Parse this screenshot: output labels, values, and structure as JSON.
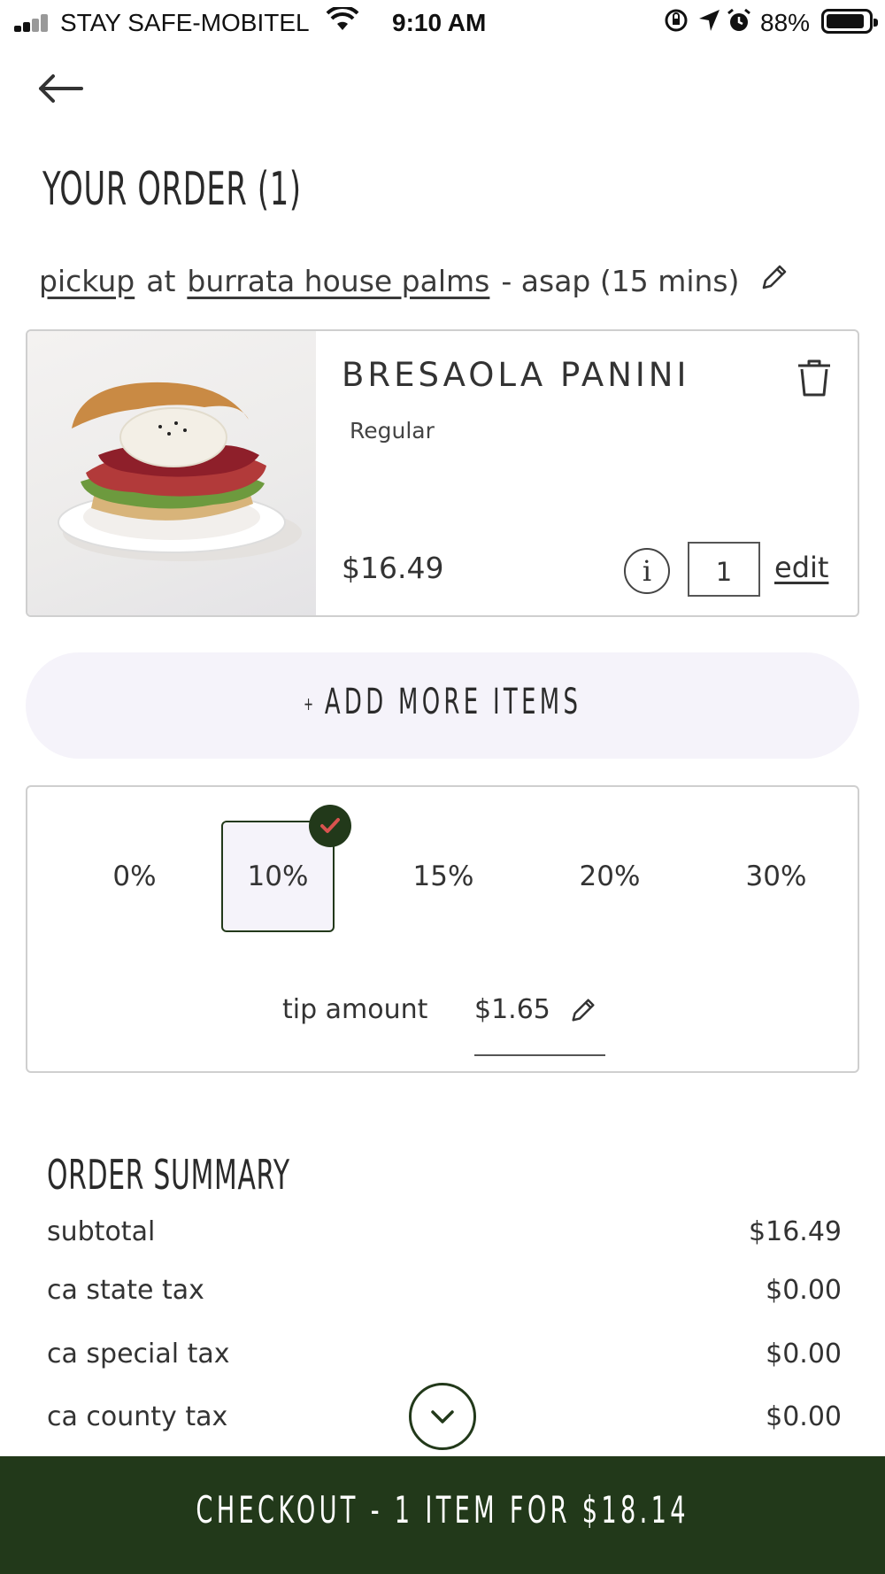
{
  "status_bar": {
    "carrier": "STAY SAFE-MOBITEL",
    "time": "9:10 AM",
    "battery": "88%",
    "icons": [
      "signal-icon",
      "wifi-icon",
      "orientation-lock-icon",
      "location-icon",
      "alarm-icon",
      "battery-icon"
    ]
  },
  "nav": {
    "back_icon": "arrow-left-icon"
  },
  "page": {
    "title": "YOUR ORDER (1)"
  },
  "pickup": {
    "mode": "pickup",
    "at": "at",
    "location": "burrata house palms",
    "time": "- asap (15 mins)",
    "edit_icon": "pencil-icon"
  },
  "item": {
    "name": "BRESAOLA PANINI",
    "variant": "Regular",
    "price": "$16.49",
    "info_label": "i",
    "quantity": "1",
    "edit_label": "edit",
    "delete_icon": "trash-icon"
  },
  "add_more": {
    "plus": "+",
    "label": "ADD MORE ITEMS"
  },
  "tip": {
    "options": [
      {
        "label": "0%",
        "selected": false
      },
      {
        "label": "10%",
        "selected": true
      },
      {
        "label": "15%",
        "selected": false
      },
      {
        "label": "20%",
        "selected": false
      },
      {
        "label": "30%",
        "selected": false
      }
    ],
    "amount_label": "tip amount",
    "amount_value": "$1.65",
    "edit_icon": "pencil-icon"
  },
  "summary": {
    "title": "ORDER SUMMARY",
    "rows": [
      {
        "label": "subtotal",
        "value": "$16.49"
      },
      {
        "label": "ca state tax",
        "value": "$0.00"
      },
      {
        "label": "ca special tax",
        "value": "$0.00"
      },
      {
        "label": "ca county tax",
        "value": "$0.00"
      }
    ],
    "scroll_icon": "chevron-down-icon"
  },
  "checkout": {
    "label": "CHECKOUT - 1 ITEM FOR $18.14"
  },
  "colors": {
    "brand_green": "#22391a",
    "soft_lavender": "#f5f3fa",
    "accent_red": "#d9534f",
    "border_gray": "#cfcfcf"
  }
}
